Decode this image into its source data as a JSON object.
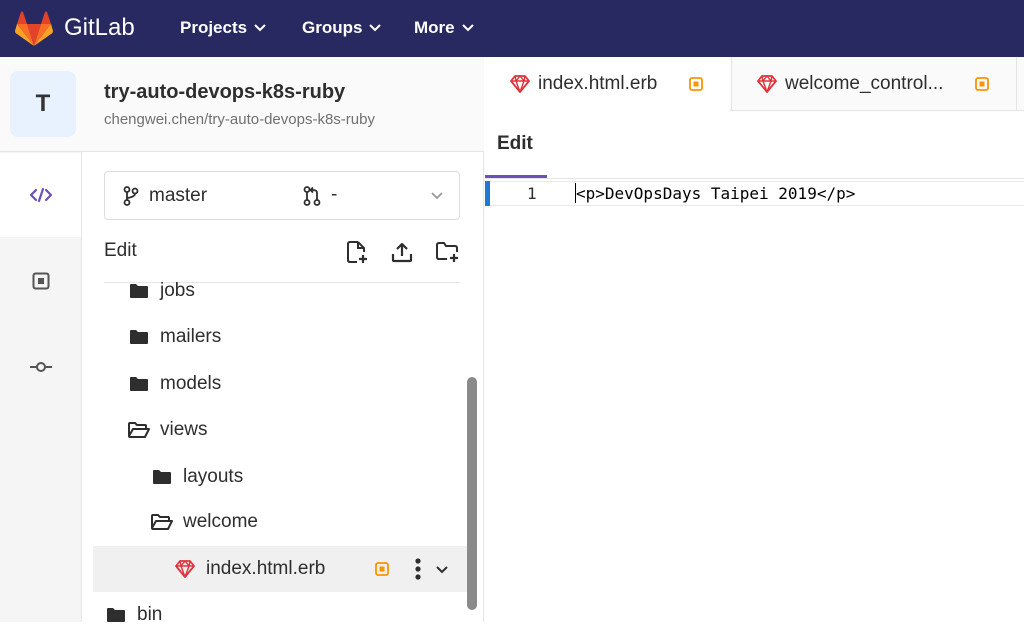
{
  "navbar": {
    "brand": "GitLab",
    "items": [
      {
        "label": "Projects"
      },
      {
        "label": "Groups"
      },
      {
        "label": "More"
      }
    ]
  },
  "project": {
    "avatar_letter": "T",
    "name": "try-auto-devops-k8s-ruby",
    "path": "chengwei.chen/try-auto-devops-k8s-ruby"
  },
  "branch": {
    "name": "master",
    "merge_request": "-"
  },
  "sidebar": {
    "edit_label": "Edit"
  },
  "tree": [
    {
      "label": "jobs",
      "type": "folder"
    },
    {
      "label": "mailers",
      "type": "folder"
    },
    {
      "label": "models",
      "type": "folder"
    },
    {
      "label": "views",
      "type": "folder-open"
    },
    {
      "label": "layouts",
      "type": "folder"
    },
    {
      "label": "welcome",
      "type": "folder-open"
    },
    {
      "label": "index.html.erb",
      "type": "ruby-file"
    },
    {
      "label": "bin",
      "type": "folder"
    }
  ],
  "tabs": [
    {
      "label": "index.html.erb"
    },
    {
      "label": "welcome_control..."
    }
  ],
  "editor": {
    "mode_tab": "Edit",
    "line_number": "1",
    "code": "<p>DevOpsDays Taipei 2019</p>"
  },
  "colors": {
    "navbar": "#292961",
    "accent": "#6b4fbb",
    "ruby": "#e0323c",
    "modified": "#fc9403"
  }
}
